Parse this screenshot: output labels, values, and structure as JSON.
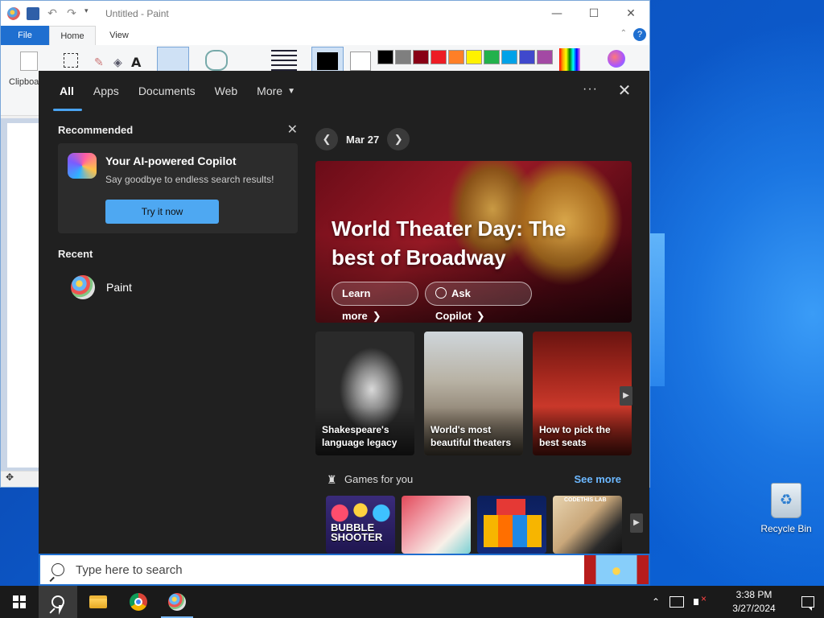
{
  "paint": {
    "title": "Untitled - Paint",
    "tabs": [
      "File",
      "Home",
      "View"
    ],
    "clipboard_label": "Clipboard",
    "palette_colors": [
      "#000000",
      "#7f7f7f",
      "#880015",
      "#ed1c24",
      "#ff7f27",
      "#fff200",
      "#22b14c",
      "#00a2e8",
      "#3f48cc",
      "#a349a4"
    ]
  },
  "search": {
    "tabs": [
      "All",
      "Apps",
      "Documents",
      "Web",
      "More"
    ],
    "recommended_label": "Recommended",
    "copilot": {
      "title": "Your AI-powered Copilot",
      "subtitle": "Say goodbye to endless search results!",
      "button": "Try it now"
    },
    "recent_label": "Recent",
    "recent_items": [
      {
        "name": "Paint"
      }
    ],
    "date_label": "Mar 27",
    "hero": {
      "title": "World Theater Day: The best of Broadway",
      "learn_more": "Learn more",
      "ask_copilot": "Ask Copilot"
    },
    "cards": [
      {
        "caption": "Shakespeare's language legacy"
      },
      {
        "caption": "World's most beautiful theaters"
      },
      {
        "caption": "How to pick the best seats"
      }
    ],
    "games": {
      "title": "Games for you",
      "see_more": "See more",
      "tiles": [
        "BUBBLE SHOOTER",
        "",
        "",
        "CODETHIS LAB"
      ]
    },
    "placeholder": "Type here to search"
  },
  "desktop": {
    "recycle_bin": "Recycle Bin"
  },
  "taskbar": {
    "time": "3:38 PM",
    "date": "3/27/2024"
  }
}
